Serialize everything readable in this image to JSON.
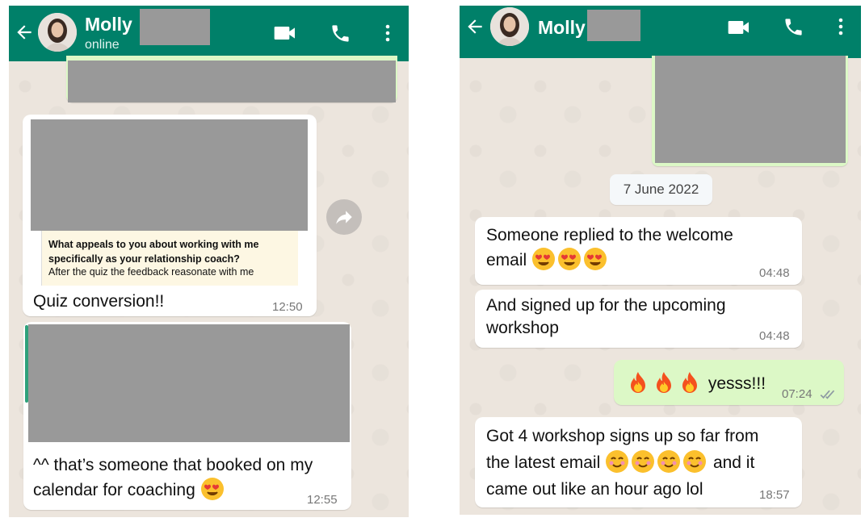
{
  "left_chat": {
    "contact_name": "Molly",
    "status": "online",
    "quoted_text_line1": "What appeals to you about working with me",
    "quoted_text_line2": "specifically as your relationship coach?",
    "quoted_text_line3": "After the quiz the feedback reasonate with me",
    "messages": [
      {
        "text": "Quiz conversion!!",
        "time": "12:50"
      },
      {
        "text_line1": "^^ that’s someone that booked on my",
        "text_line2": "calendar for coaching",
        "emoji": "heart-eyes",
        "time": "12:55"
      }
    ]
  },
  "right_chat": {
    "contact_name": "Molly",
    "date_divider": "7 June 2022",
    "messages": [
      {
        "text_line1": "Someone replied to the welcome",
        "text_line2": "email",
        "emojis": [
          "heart-eyes",
          "heart-eyes",
          "heart-eyes"
        ],
        "time": "04:48"
      },
      {
        "text_line1": "And signed up for the upcoming",
        "text_line2": "workshop",
        "time": "04:48"
      },
      {
        "text": "yesss!!!",
        "emojis": [
          "fire",
          "fire",
          "fire"
        ],
        "time": "07:24",
        "outgoing": true,
        "read": true
      },
      {
        "text_line1": "Got 4 workshop signs up so far from",
        "text_line2a": "the latest email",
        "text_line2b": "and it",
        "text_line3": "came out like an hour ago lol",
        "emojis": [
          "smiling",
          "smiling",
          "smiling",
          "smiling"
        ],
        "time": "18:57"
      }
    ]
  },
  "colors": {
    "header": "#008069",
    "incoming_bubble": "#ffffff",
    "outgoing_bubble": "#dcf8c6",
    "wallpaper": "#ece5dd",
    "redaction": "#999999",
    "read_ticks": "#8e9aa3"
  }
}
